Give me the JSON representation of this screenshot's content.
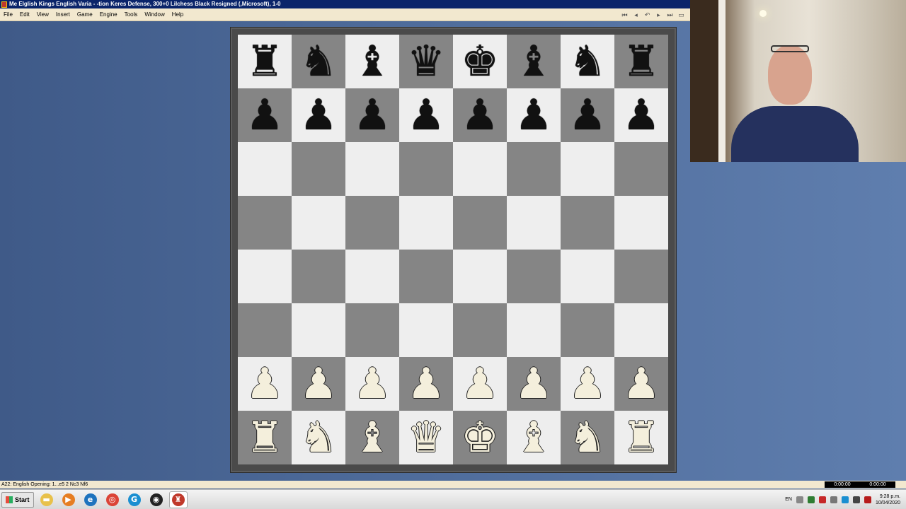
{
  "window": {
    "title": "Me Elglish Kings English Varia - -tion Keres Defense, 300+0 Lilchess Black Resigned  (,Microsoft), 1-0"
  },
  "menu": {
    "items": [
      "File",
      "Edit",
      "View",
      "Insert",
      "Game",
      "Engine",
      "Tools",
      "Window",
      "Help"
    ],
    "nav_icons": [
      "first-move-icon",
      "previous-move-icon",
      "take-back-icon",
      "next-move-icon",
      "last-move-icon",
      "folder-icon"
    ]
  },
  "board": {
    "light_color": "#eeeeee",
    "dark_color": "#858585",
    "ranks": [
      [
        "bR",
        "bN",
        "bB",
        "bQ",
        "bK",
        "bB",
        "bN",
        "bR"
      ],
      [
        "bP",
        "bP",
        "bP",
        "bP",
        "bP",
        "bP",
        "bP",
        "bP"
      ],
      [
        "",
        "",
        "",
        "",
        "",
        "",
        "",
        ""
      ],
      [
        "",
        "",
        "",
        "",
        "",
        "",
        "",
        ""
      ],
      [
        "",
        "",
        "",
        "",
        "",
        "",
        "",
        ""
      ],
      [
        "",
        "",
        "",
        "",
        "",
        "",
        "",
        ""
      ],
      [
        "wP",
        "wP",
        "wP",
        "wP",
        "wP",
        "wP",
        "wP",
        "wP"
      ],
      [
        "wR",
        "wN",
        "wB",
        "wQ",
        "wK",
        "wB",
        "wN",
        "wR"
      ]
    ]
  },
  "status": {
    "opening": "A22: English Opening: 1...e5 2 Nc3 Nf6",
    "white_clock": "0:00:00",
    "black_clock": "0:00:00"
  },
  "taskbar": {
    "start_label": "Start",
    "apps": [
      {
        "name": "file-explorer-icon",
        "glyph": "▬",
        "color": "#e8c14a"
      },
      {
        "name": "media-player-icon",
        "glyph": "▶",
        "color": "#e67e22"
      },
      {
        "name": "internet-explorer-icon",
        "glyph": "e",
        "color": "#1e73be"
      },
      {
        "name": "chrome-icon",
        "glyph": "◎",
        "color": "#db4437"
      },
      {
        "name": "g-app-icon",
        "glyph": "G",
        "color": "#1a8fd1"
      },
      {
        "name": "obs-icon",
        "glyph": "◉",
        "color": "#222222"
      },
      {
        "name": "chess-app-icon",
        "glyph": "♜",
        "color": "#c0392b"
      }
    ],
    "language": "EN",
    "time": "9:28 p.m.",
    "date": "10/04/2020"
  }
}
